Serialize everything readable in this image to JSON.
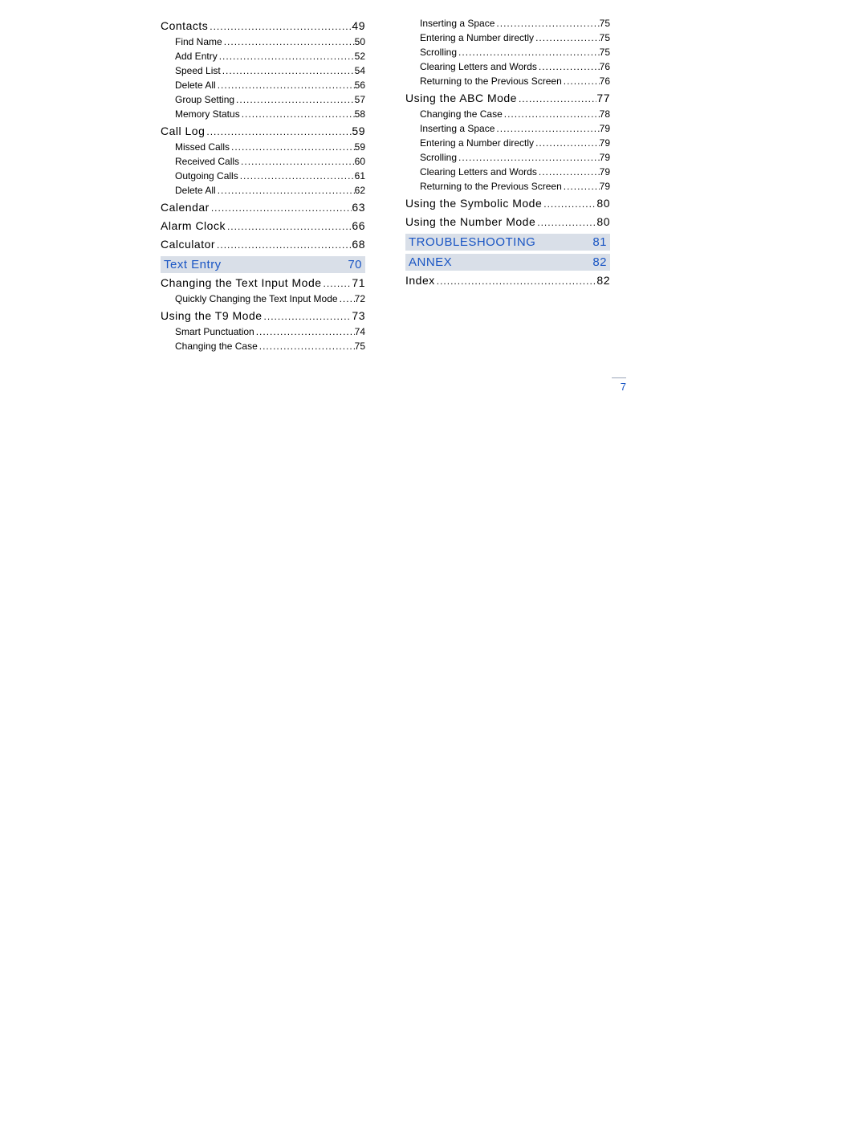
{
  "page_number": "7",
  "left_column": [
    {
      "type": "l1",
      "label": "Contacts",
      "page": "49"
    },
    {
      "type": "l2",
      "label": "Find Name",
      "page": "50"
    },
    {
      "type": "l2",
      "label": "Add Entry",
      "page": "52"
    },
    {
      "type": "l2",
      "label": "Speed List",
      "page": "54"
    },
    {
      "type": "l2",
      "label": "Delete All",
      "page": "56"
    },
    {
      "type": "l2",
      "label": "Group Setting",
      "page": "57"
    },
    {
      "type": "l2",
      "label": "Memory Status",
      "page": "58"
    },
    {
      "type": "l1",
      "label": "Call Log",
      "page": "59"
    },
    {
      "type": "l2",
      "label": "Missed Calls",
      "page": "59"
    },
    {
      "type": "l2",
      "label": "Received Calls",
      "page": "60"
    },
    {
      "type": "l2",
      "label": "Outgoing Calls",
      "page": "61"
    },
    {
      "type": "l2",
      "label": "Delete All",
      "page": "62"
    },
    {
      "type": "l1",
      "label": "Calendar",
      "page": "63"
    },
    {
      "type": "l1",
      "label": "Alarm Clock",
      "page": "66"
    },
    {
      "type": "l1",
      "label": "Calculator",
      "page": "68"
    },
    {
      "type": "section",
      "label": "Text Entry",
      "page": "70"
    },
    {
      "type": "l1",
      "label": "Changing the Text Input Mode",
      "page": "71"
    },
    {
      "type": "l2",
      "label": "Quickly Changing the Text Input Mode",
      "page": "72"
    },
    {
      "type": "l1",
      "label": "Using the T9 Mode",
      "page": "73"
    },
    {
      "type": "l2",
      "label": "Smart Punctuation",
      "page": "74"
    },
    {
      "type": "l2",
      "label": "Changing the Case",
      "page": "75"
    }
  ],
  "right_column": [
    {
      "type": "l2",
      "label": "Inserting a Space",
      "page": "75"
    },
    {
      "type": "l2",
      "label": "Entering a Number directly",
      "page": "75"
    },
    {
      "type": "l2",
      "label": "Scrolling",
      "page": "75"
    },
    {
      "type": "l2",
      "label": "Clearing Letters and Words",
      "page": "76"
    },
    {
      "type": "l2",
      "label": "Returning to the Previous Screen",
      "page": "76"
    },
    {
      "type": "l1",
      "label": "Using the ABC Mode",
      "page": "77"
    },
    {
      "type": "l2",
      "label": "Changing the Case",
      "page": "78"
    },
    {
      "type": "l2",
      "label": "Inserting a Space",
      "page": "79"
    },
    {
      "type": "l2",
      "label": "Entering a Number directly",
      "page": "79"
    },
    {
      "type": "l2",
      "label": "Scrolling",
      "page": "79"
    },
    {
      "type": "l2",
      "label": "Clearing Letters and Words",
      "page": "79"
    },
    {
      "type": "l2",
      "label": "Returning to the Previous Screen",
      "page": "79"
    },
    {
      "type": "l1",
      "label": "Using the Symbolic Mode",
      "page": "80"
    },
    {
      "type": "l1",
      "label": "Using the Number Mode",
      "page": "80"
    },
    {
      "type": "section",
      "label": "TROUBLESHOOTING",
      "page": "81"
    },
    {
      "type": "section",
      "label": "ANNEX",
      "page": "82"
    },
    {
      "type": "l1",
      "label": "Index",
      "page": "82"
    }
  ]
}
